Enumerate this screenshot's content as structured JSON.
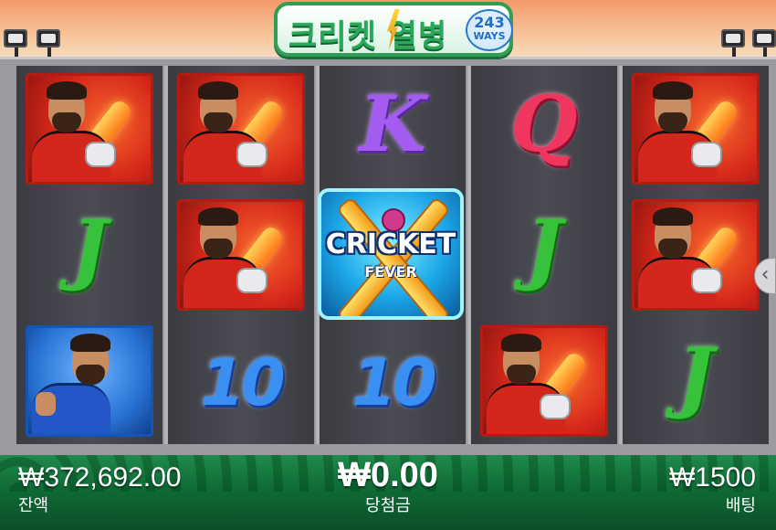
{
  "title": {
    "logo_text": "크리켓 열병",
    "ways_number": "243",
    "ways_label": "WAYS"
  },
  "reels": {
    "symbols": [
      [
        "batsman-red",
        "letter-j",
        "batsman-blue"
      ],
      [
        "batsman-red",
        "batsman-red",
        "number-10"
      ],
      [
        "letter-k",
        "wild-cricket-fever",
        "number-10"
      ],
      [
        "letter-q",
        "letter-j",
        "batsman-red"
      ],
      [
        "batsman-red",
        "batsman-red",
        "letter-j"
      ]
    ],
    "glyphs": {
      "k": "K",
      "q": "Q",
      "j": "J",
      "ten": "10"
    },
    "wild": {
      "line1": "CRICKET",
      "line2": "FEVER"
    }
  },
  "footer": {
    "balance_value": "₩372,692.00",
    "balance_label": "잔액",
    "win_value": "₩0.00",
    "win_label": "당첨금",
    "bet_value": "₩1500",
    "bet_label": "배팅"
  },
  "colors": {
    "accent_green": "#2aa75a",
    "tile_red": "#d6281a",
    "tile_blue": "#2a74d6",
    "wild_cyan": "#1ba6e8",
    "bar_green": "#0f6b35"
  }
}
